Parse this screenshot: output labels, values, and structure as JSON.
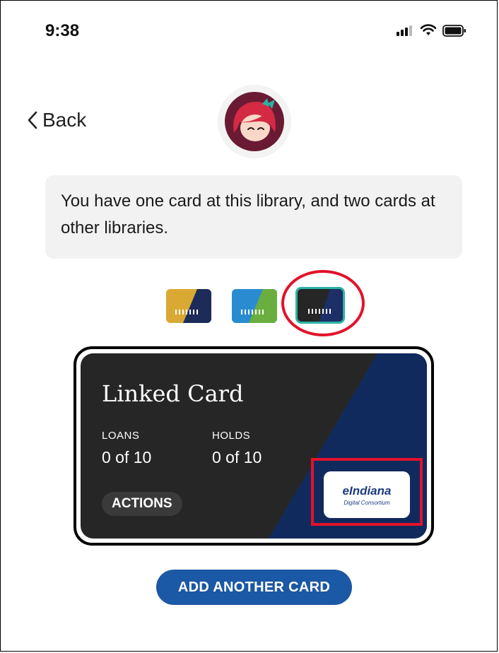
{
  "status_bar": {
    "time": "9:38"
  },
  "nav": {
    "back_label": "Back"
  },
  "message": "You have one card at this library, and two cards at other libraries.",
  "card_chips": [
    {
      "name": "card-chip-gold",
      "colors": [
        "#d9a933",
        "#1c2b5a"
      ],
      "selected": false
    },
    {
      "name": "card-chip-blue-green",
      "colors": [
        "#2a8bd0",
        "#6aae3f"
      ],
      "selected": false
    },
    {
      "name": "card-chip-dark",
      "colors": [
        "#262626",
        "#1c2f66"
      ],
      "selected": true,
      "ring_color": "#2bb3a4"
    }
  ],
  "card": {
    "title": "Linked Card",
    "loans_label": "LOANS",
    "loans_value": "0 of 10",
    "holds_label": "HOLDS",
    "holds_value": "0 of 10",
    "actions_label": "ACTIONS",
    "partner_name": "eIndiana",
    "partner_subtitle": "Digital Consortium",
    "colors": {
      "base": "#262626",
      "accent": "#112a5e"
    }
  },
  "add_card_label": "ADD ANOTHER CARD",
  "colors": {
    "highlight": "#e3122a",
    "primary_button": "#1b58a5"
  }
}
